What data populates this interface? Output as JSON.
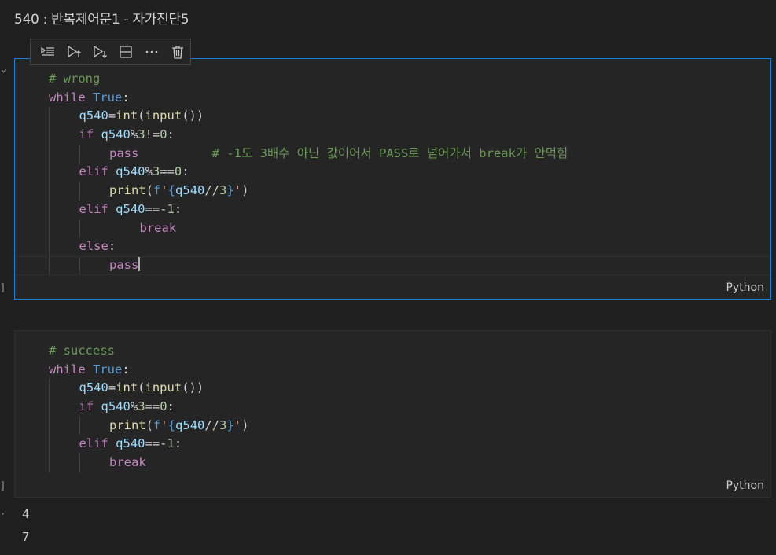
{
  "notebook": {
    "title": "540 : 반복제어문1 - 자가진단5"
  },
  "toolbar": {
    "items": [
      {
        "name": "execute-above-icon"
      },
      {
        "name": "execute-cell-and-above-icon"
      },
      {
        "name": "execute-cell-and-below-icon"
      },
      {
        "name": "split-cell-icon"
      },
      {
        "name": "more-actions-icon"
      },
      {
        "name": "delete-cell-icon"
      }
    ]
  },
  "cells": [
    {
      "language": "Python",
      "lines": [
        {
          "indent": 0,
          "tokens": [
            {
              "c": "comment",
              "t": "# wrong"
            }
          ]
        },
        {
          "indent": 0,
          "tokens": [
            {
              "c": "kw",
              "t": "while"
            },
            {
              "c": "op",
              "t": " "
            },
            {
              "c": "const",
              "t": "True"
            },
            {
              "c": "op",
              "t": ":"
            }
          ]
        },
        {
          "indent": 1,
          "tokens": [
            {
              "c": "var",
              "t": "q540"
            },
            {
              "c": "op",
              "t": "="
            },
            {
              "c": "fn",
              "t": "int"
            },
            {
              "c": "op",
              "t": "("
            },
            {
              "c": "fn",
              "t": "input"
            },
            {
              "c": "op",
              "t": "())"
            }
          ]
        },
        {
          "indent": 1,
          "tokens": [
            {
              "c": "kw",
              "t": "if"
            },
            {
              "c": "op",
              "t": " "
            },
            {
              "c": "var",
              "t": "q540"
            },
            {
              "c": "op",
              "t": "%"
            },
            {
              "c": "num",
              "t": "3"
            },
            {
              "c": "op",
              "t": "!="
            },
            {
              "c": "num",
              "t": "0"
            },
            {
              "c": "op",
              "t": ":"
            }
          ]
        },
        {
          "indent": 2,
          "tokens": [
            {
              "c": "kw",
              "t": "pass"
            },
            {
              "c": "op",
              "t": "          "
            },
            {
              "c": "comment",
              "t": "# -1도 3배수 아닌 값이어서 PASS로 넘어가서 break가 안먹힘"
            }
          ]
        },
        {
          "indent": 1,
          "tokens": [
            {
              "c": "kw",
              "t": "elif"
            },
            {
              "c": "op",
              "t": " "
            },
            {
              "c": "var",
              "t": "q540"
            },
            {
              "c": "op",
              "t": "%"
            },
            {
              "c": "num",
              "t": "3"
            },
            {
              "c": "op",
              "t": "=="
            },
            {
              "c": "num",
              "t": "0"
            },
            {
              "c": "op",
              "t": ":"
            }
          ]
        },
        {
          "indent": 2,
          "tokens": [
            {
              "c": "fn",
              "t": "print"
            },
            {
              "c": "op",
              "t": "("
            },
            {
              "c": "const",
              "t": "f"
            },
            {
              "c": "str",
              "t": "'"
            },
            {
              "c": "const",
              "t": "{"
            },
            {
              "c": "var",
              "t": "q540"
            },
            {
              "c": "op",
              "t": "//"
            },
            {
              "c": "num",
              "t": "3"
            },
            {
              "c": "const",
              "t": "}"
            },
            {
              "c": "str",
              "t": "'"
            },
            {
              "c": "op",
              "t": ")"
            }
          ]
        },
        {
          "indent": 1,
          "tokens": [
            {
              "c": "kw",
              "t": "elif"
            },
            {
              "c": "op",
              "t": " "
            },
            {
              "c": "var",
              "t": "q540"
            },
            {
              "c": "op",
              "t": "=="
            },
            {
              "c": "op",
              "t": "-"
            },
            {
              "c": "num",
              "t": "1"
            },
            {
              "c": "op",
              "t": ":"
            }
          ]
        },
        {
          "indent": 3,
          "guides": 2,
          "tokens": [
            {
              "c": "kw",
              "t": "break"
            }
          ]
        },
        {
          "indent": 1,
          "tokens": [
            {
              "c": "kw",
              "t": "else"
            },
            {
              "c": "op",
              "t": ":"
            }
          ]
        },
        {
          "indent": 2,
          "current": true,
          "cursor": true,
          "tokens": [
            {
              "c": "kw",
              "t": "pass"
            }
          ]
        }
      ]
    },
    {
      "language": "Python",
      "lines": [
        {
          "indent": 0,
          "tokens": [
            {
              "c": "comment",
              "t": "# success"
            }
          ]
        },
        {
          "indent": 0,
          "tokens": [
            {
              "c": "kw",
              "t": "while"
            },
            {
              "c": "op",
              "t": " "
            },
            {
              "c": "const",
              "t": "True"
            },
            {
              "c": "op",
              "t": ":"
            }
          ]
        },
        {
          "indent": 1,
          "tokens": [
            {
              "c": "var",
              "t": "q540"
            },
            {
              "c": "op",
              "t": "="
            },
            {
              "c": "fn",
              "t": "int"
            },
            {
              "c": "op",
              "t": "("
            },
            {
              "c": "fn",
              "t": "input"
            },
            {
              "c": "op",
              "t": "())"
            }
          ]
        },
        {
          "indent": 1,
          "tokens": [
            {
              "c": "kw",
              "t": "if"
            },
            {
              "c": "op",
              "t": " "
            },
            {
              "c": "var",
              "t": "q540"
            },
            {
              "c": "op",
              "t": "%"
            },
            {
              "c": "num",
              "t": "3"
            },
            {
              "c": "op",
              "t": "=="
            },
            {
              "c": "num",
              "t": "0"
            },
            {
              "c": "op",
              "t": ":"
            }
          ]
        },
        {
          "indent": 2,
          "tokens": [
            {
              "c": "fn",
              "t": "print"
            },
            {
              "c": "op",
              "t": "("
            },
            {
              "c": "const",
              "t": "f"
            },
            {
              "c": "str",
              "t": "'"
            },
            {
              "c": "const",
              "t": "{"
            },
            {
              "c": "var",
              "t": "q540"
            },
            {
              "c": "op",
              "t": "//"
            },
            {
              "c": "num",
              "t": "3"
            },
            {
              "c": "const",
              "t": "}"
            },
            {
              "c": "str",
              "t": "'"
            },
            {
              "c": "op",
              "t": ")"
            }
          ]
        },
        {
          "indent": 1,
          "tokens": [
            {
              "c": "kw",
              "t": "elif"
            },
            {
              "c": "op",
              "t": " "
            },
            {
              "c": "var",
              "t": "q540"
            },
            {
              "c": "op",
              "t": "=="
            },
            {
              "c": "op",
              "t": "-"
            },
            {
              "c": "num",
              "t": "1"
            },
            {
              "c": "op",
              "t": ":"
            }
          ]
        },
        {
          "indent": 2,
          "tokens": [
            {
              "c": "kw",
              "t": "break"
            }
          ]
        }
      ]
    }
  ],
  "output": {
    "lines": [
      "4",
      "7"
    ]
  },
  "colors": {
    "accent": "#1b81d6",
    "background": "#1f1f1f",
    "cell_background": "#252526"
  }
}
